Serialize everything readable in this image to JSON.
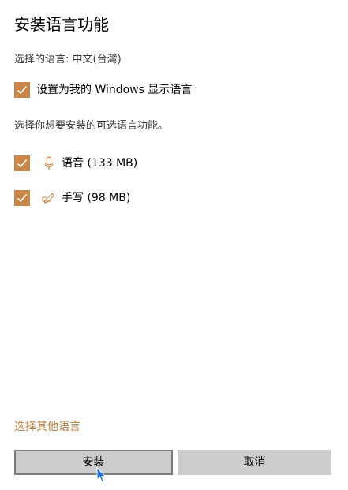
{
  "page": {
    "title": "安装语言功能",
    "selected_language": "选择的语言: 中文(台灣)"
  },
  "display_language": {
    "label": "设置为我的 Windows 显示语言",
    "checked": true
  },
  "instructions": "选择你想要安装的可选语言功能。",
  "features": [
    {
      "icon": "microphone-icon",
      "label": "语音 (133 MB)",
      "checked": true
    },
    {
      "icon": "handwriting-pen-icon",
      "label": "手写 (98 MB)",
      "checked": true
    }
  ],
  "links": {
    "other_language": "选择其他语言"
  },
  "buttons": {
    "install": "安装",
    "cancel": "取消"
  },
  "colors": {
    "accent": "#c8864a",
    "link": "#b07a3c",
    "button_bg": "#cccccc",
    "focus_border": "#7a7a7a"
  }
}
